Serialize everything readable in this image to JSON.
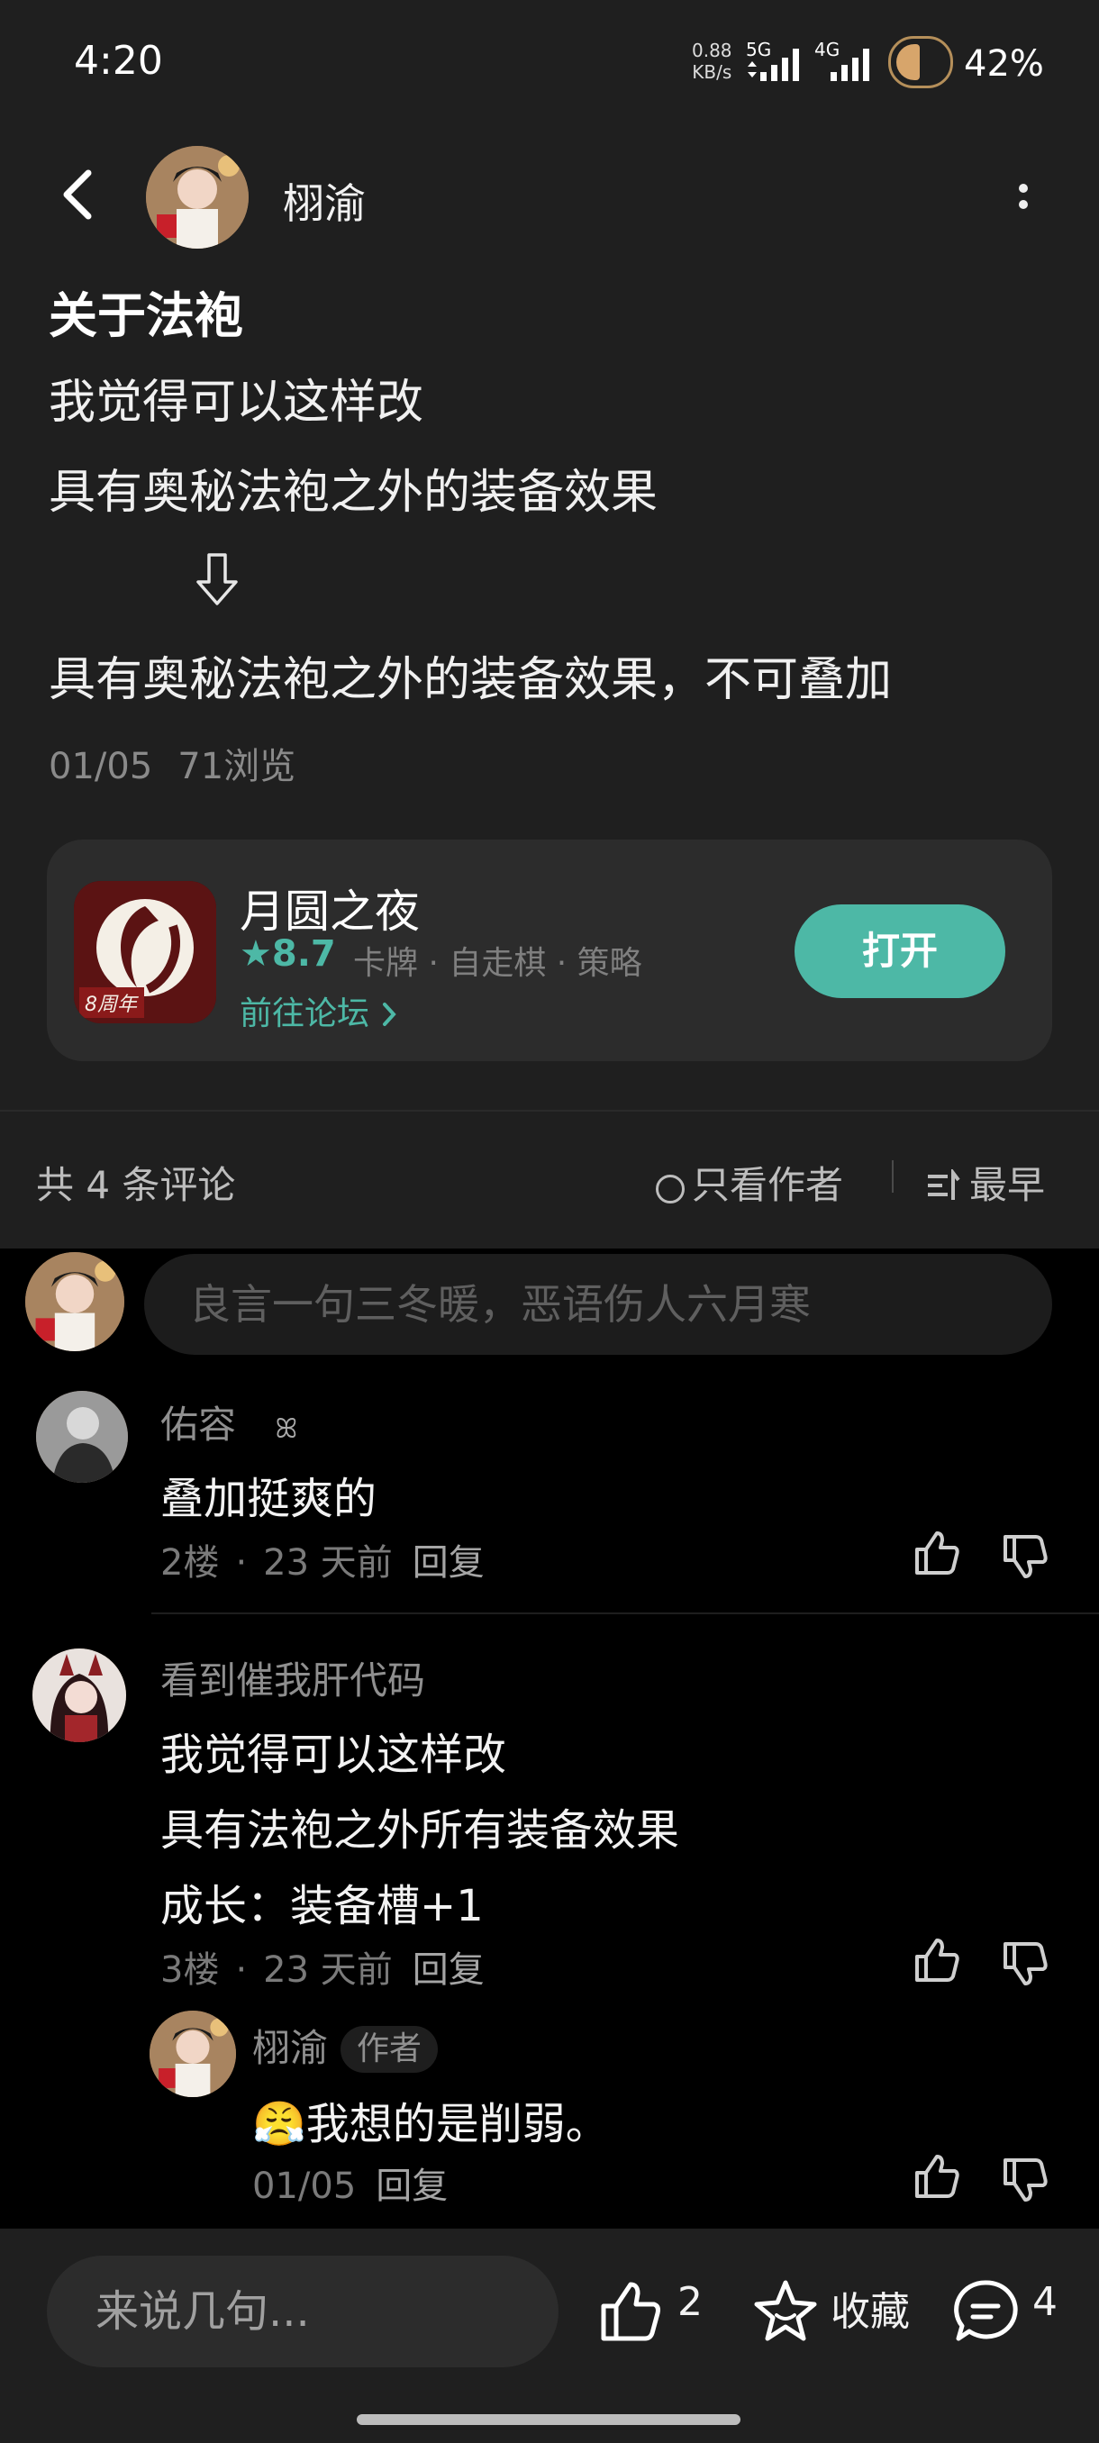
{
  "status_bar": {
    "time": "4:20",
    "net_speed_value": "0.88",
    "net_speed_unit": "KB/s",
    "sim1_label": "5G",
    "sim2_label": "4G",
    "battery_pct": "42%",
    "battery_level": 0.42
  },
  "header": {
    "author_name": "栩渝"
  },
  "post": {
    "title": "关于法袍",
    "lines": [
      "我觉得可以这样改",
      "具有奥秘法袍之外的装备效果",
      "具有奥秘法袍之外的装备效果，不可叠加"
    ],
    "arrow_glyph": "⇩",
    "date": "01/05",
    "views": "71浏览"
  },
  "game_card": {
    "name": "月圆之夜",
    "rating": "8.7",
    "tags": "卡牌 · 自走棋 · 策略",
    "forum_link": "前往论坛",
    "open_button": "打开",
    "icon_badge": "8周年"
  },
  "comments_header": {
    "count": "共 4 条评论",
    "author_only": "只看作者",
    "sort": "最早"
  },
  "comment_input": {
    "placeholder": "良言一句三冬暖，恶语伤人六月寒"
  },
  "comments": [
    {
      "name": "佑容",
      "text": "叠加挺爽的",
      "floor": "2楼",
      "time": "23 天前",
      "reply": "回复"
    },
    {
      "name": "看到催我肝代码",
      "lines": [
        "我觉得可以这样改",
        "具有法袍之外所有装备效果",
        "成长：装备槽+1"
      ],
      "floor": "3楼",
      "time": "23 天前",
      "reply": "回复"
    }
  ],
  "sub_reply": {
    "name": "栩渝",
    "tag": "作者",
    "emoji": "😤",
    "text": "我想的是削弱。",
    "date": "01/05",
    "reply": "回复"
  },
  "bottom_bar": {
    "input_placeholder": "来说几句...",
    "likes": "2",
    "favorite": "收藏",
    "comments": "4"
  },
  "colors": {
    "accent": "#4db8a6",
    "background": "#000000",
    "surface": "#1f1f1f",
    "card": "#2c2c2c"
  }
}
